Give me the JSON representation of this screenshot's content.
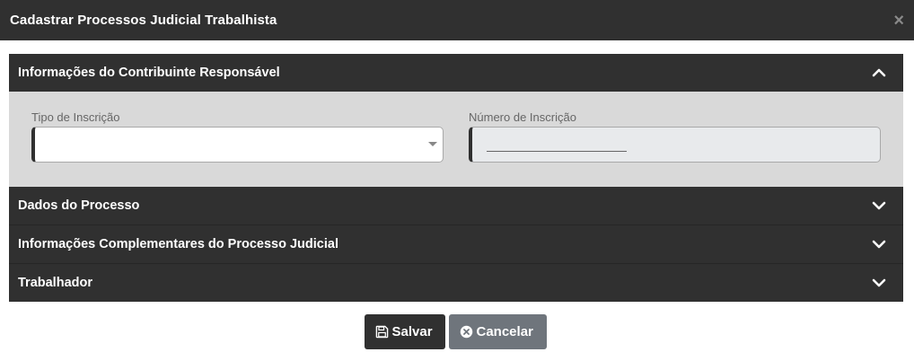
{
  "modal": {
    "title": "Cadastrar Processos Judicial Trabalhista",
    "close_glyph": "×"
  },
  "panels": [
    {
      "title": "Informações do Contribuinte Responsável",
      "expanded": true,
      "icon": "chevron-up-icon"
    },
    {
      "title": "Dados do Processo",
      "expanded": false,
      "icon": "chevron-down-icon"
    },
    {
      "title": "Informações Complementares do Processo Judicial",
      "expanded": false,
      "icon": "chevron-down-icon"
    },
    {
      "title": "Trabalhador",
      "expanded": false,
      "icon": "chevron-down-icon"
    }
  ],
  "fields": {
    "tipo_inscricao": {
      "label": "Tipo de Inscrição",
      "value": ""
    },
    "numero_inscricao": {
      "label": "Número de Inscrição",
      "value": ""
    }
  },
  "buttons": {
    "save": {
      "label": "Salvar",
      "icon": "floppy-disk-icon"
    },
    "cancel": {
      "label": "Cancelar",
      "icon": "circle-x-icon"
    }
  },
  "colors": {
    "header_bg": "#303030",
    "panel_body_bg": "#d9d9d9",
    "cancel_bg": "#6f757c",
    "readonly_input_bg": "#e8eaec"
  }
}
